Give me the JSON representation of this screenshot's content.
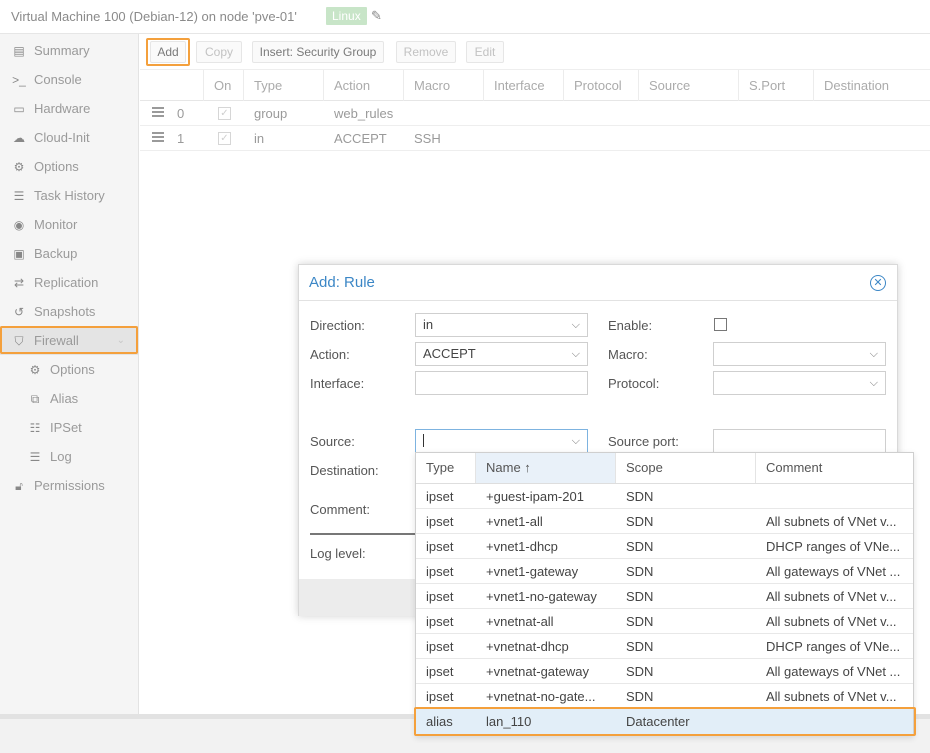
{
  "header": {
    "vm_title": "Virtual Machine 100 (Debian-12) on node 'pve-01'",
    "tag": "Linux",
    "tag_edit_icon": "pencil-icon"
  },
  "sidebar": {
    "items": [
      {
        "label": "Summary",
        "icon": "book-icon"
      },
      {
        "label": "Console",
        "icon": "terminal-icon"
      },
      {
        "label": "Hardware",
        "icon": "desktop-icon"
      },
      {
        "label": "Cloud-Init",
        "icon": "cloud-icon"
      },
      {
        "label": "Options",
        "icon": "gear-icon"
      },
      {
        "label": "Task History",
        "icon": "list-icon"
      },
      {
        "label": "Monitor",
        "icon": "eye-icon"
      },
      {
        "label": "Backup",
        "icon": "floppy-icon"
      },
      {
        "label": "Replication",
        "icon": "retweet-icon"
      },
      {
        "label": "Snapshots",
        "icon": "history-icon"
      },
      {
        "label": "Firewall",
        "icon": "shield-icon"
      },
      {
        "label": "Options",
        "icon": "gear-icon"
      },
      {
        "label": "Alias",
        "icon": "external-link-icon"
      },
      {
        "label": "IPSet",
        "icon": "list-ol-icon"
      },
      {
        "label": "Log",
        "icon": "list-icon"
      },
      {
        "label": "Permissions",
        "icon": "unlock-icon"
      }
    ]
  },
  "toolbar": {
    "add": "Add",
    "copy": "Copy",
    "insert_sg": "Insert: Security Group",
    "remove": "Remove",
    "edit": "Edit"
  },
  "grid": {
    "columns": [
      "On",
      "Type",
      "Action",
      "Macro",
      "Interface",
      "Protocol",
      "Source",
      "S.Port",
      "Destination"
    ],
    "rows": [
      {
        "pos": "0",
        "type": "group",
        "action": "web_rules",
        "macro": ""
      },
      {
        "pos": "1",
        "type": "in",
        "action": "ACCEPT",
        "macro": "SSH"
      }
    ]
  },
  "dialog": {
    "title": "Add: Rule",
    "direction_label": "Direction:",
    "direction_value": "in",
    "action_label": "Action:",
    "action_value": "ACCEPT",
    "interface_label": "Interface:",
    "enable_label": "Enable:",
    "macro_label": "Macro:",
    "protocol_label": "Protocol:",
    "source_label": "Source:",
    "source_port_label": "Source port:",
    "destination_label": "Destination:",
    "comment_label": "Comment:",
    "log_level_label": "Log level:"
  },
  "picker": {
    "columns": {
      "type": "Type",
      "name": "Name ↑",
      "scope": "Scope",
      "comment": "Comment"
    },
    "rows": [
      {
        "type": "ipset",
        "name": "+guest-ipam-201",
        "scope": "SDN",
        "comment": ""
      },
      {
        "type": "ipset",
        "name": "+vnet1-all",
        "scope": "SDN",
        "comment": "All subnets of VNet v..."
      },
      {
        "type": "ipset",
        "name": "+vnet1-dhcp",
        "scope": "SDN",
        "comment": "DHCP ranges of VNe..."
      },
      {
        "type": "ipset",
        "name": "+vnet1-gateway",
        "scope": "SDN",
        "comment": "All gateways of VNet ..."
      },
      {
        "type": "ipset",
        "name": "+vnet1-no-gateway",
        "scope": "SDN",
        "comment": "All subnets of VNet v..."
      },
      {
        "type": "ipset",
        "name": "+vnetnat-all",
        "scope": "SDN",
        "comment": "All subnets of VNet v..."
      },
      {
        "type": "ipset",
        "name": "+vnetnat-dhcp",
        "scope": "SDN",
        "comment": "DHCP ranges of VNe..."
      },
      {
        "type": "ipset",
        "name": "+vnetnat-gateway",
        "scope": "SDN",
        "comment": "All gateways of VNet ..."
      },
      {
        "type": "ipset",
        "name": "+vnetnat-no-gate...",
        "scope": "SDN",
        "comment": "All subnets of VNet v..."
      },
      {
        "type": "alias",
        "name": "lan_110",
        "scope": "Datacenter",
        "comment": ""
      }
    ]
  },
  "colors": {
    "highlight": "#f4a03c",
    "title_blue": "#3c87c6",
    "tag_green": "#c8e5c8"
  }
}
